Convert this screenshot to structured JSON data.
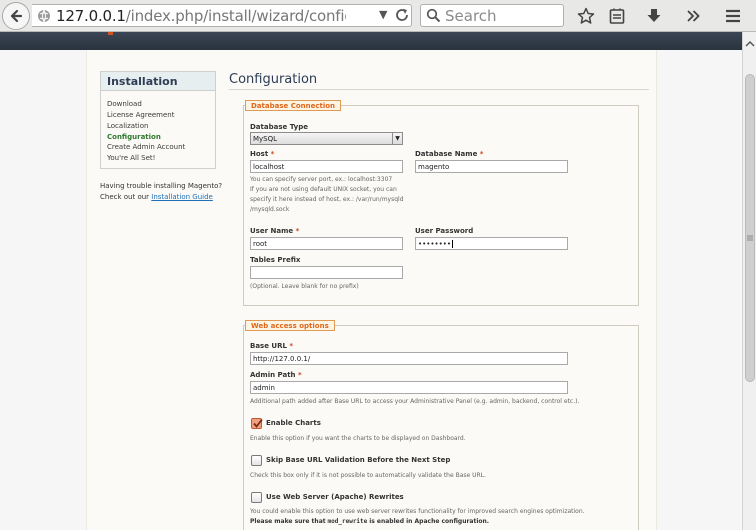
{
  "browser": {
    "url_host": "127.0.0.1",
    "url_path": "/index.php/install/wizard/config/?conf",
    "search_placeholder": "Search"
  },
  "sidebar": {
    "title": "Installation",
    "steps": [
      "Download",
      "License Agreement",
      "Localization",
      "Configuration",
      "Create Admin Account",
      "You're All Set!"
    ],
    "active_step": "Configuration",
    "trouble_text": "Having trouble installing Magento?",
    "checkout_text": "Check out our",
    "guide_link": "Installation Guide"
  },
  "main": {
    "title": "Configuration",
    "db": {
      "legend": "Database Connection",
      "type_label": "Database Type",
      "type_value": "MySQL",
      "host_label": "Host",
      "host_value": "localhost",
      "host_note_1": "You can specify server port, ex.: localhost:3307",
      "host_note_2": "If you are not using default UNIX socket, you can",
      "host_note_3": "specify it here instead of host, ex.: /var/run/mysqld",
      "host_note_4": "/mysqld.sock",
      "dbname_label": "Database Name",
      "dbname_value": "magento",
      "user_label": "User Name",
      "user_value": "root",
      "pass_label": "User Password",
      "pass_value": "••••••••",
      "prefix_label": "Tables Prefix",
      "prefix_value": "",
      "prefix_note": "(Optional. Leave blank for no prefix)"
    },
    "web": {
      "legend": "Web access options",
      "base_url_label": "Base URL",
      "base_url_value": "http://127.0.0.1/",
      "admin_path_label": "Admin Path",
      "admin_path_value": "admin",
      "admin_path_note": "Additional path added after Base URL to access your Administrative Panel (e.g. admin, backend, control etc.).",
      "charts_label": "Enable Charts",
      "charts_checked": true,
      "charts_note": "Enable this option if you want the charts to be displayed on Dashboard.",
      "skip_label": "Skip Base URL Validation Before the Next Step",
      "skip_checked": false,
      "skip_note": "Check this box only if it is not possible to automatically validate the Base URL.",
      "rewrite_label": "Use Web Server (Apache) Rewrites",
      "rewrite_checked": false,
      "rewrite_note": "You could enable this option to use web server rewrites functionality for improved search engines optimization.",
      "rewrite_note_2a": "Please make sure that",
      "rewrite_note_2b": "mod_rewrite",
      "rewrite_note_2c": "is enabled in Apache configuration."
    }
  },
  "colors": {
    "accent_orange": "#e0661b",
    "title_navy": "#2e3d55",
    "link_blue": "#1d6fb8",
    "active_green": "#2f7a2f"
  }
}
